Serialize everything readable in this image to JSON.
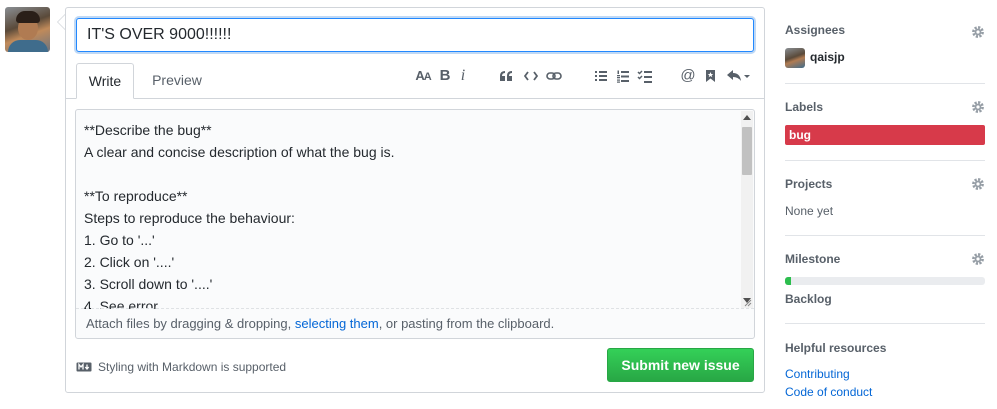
{
  "issue": {
    "title_value": "IT'S OVER 9000!!!!!!",
    "tabs": {
      "write": "Write",
      "preview": "Preview"
    },
    "toolbar": [
      {
        "name": "header-icon",
        "glyph": "AA"
      },
      {
        "name": "bold-icon",
        "glyph": "B"
      },
      {
        "name": "italic-icon",
        "glyph": "i"
      },
      {
        "name": "quote-icon",
        "glyph": "quote"
      },
      {
        "name": "code-icon",
        "glyph": "code"
      },
      {
        "name": "link-icon",
        "glyph": "link"
      },
      {
        "name": "unordered-list-icon",
        "glyph": "ul"
      },
      {
        "name": "ordered-list-icon",
        "glyph": "ol"
      },
      {
        "name": "task-list-icon",
        "glyph": "tasks"
      },
      {
        "name": "mention-icon",
        "glyph": "@"
      },
      {
        "name": "saved-reply-icon",
        "glyph": "bookmark"
      },
      {
        "name": "reply-icon",
        "glyph": "reply"
      }
    ],
    "body_lines": [
      "**Describe the bug**",
      "A clear and concise description of what the bug is.",
      "",
      "**To reproduce**",
      "Steps to reproduce the behaviour:",
      "1. Go to '...'",
      "2. Click on '....'",
      "3. Scroll down to '....'",
      "4. See error"
    ],
    "attach_prefix": "Attach files by dragging & dropping, ",
    "attach_link": "selecting them",
    "attach_suffix": ", or pasting from the clipboard.",
    "markdown_note": "Styling with Markdown is supported",
    "submit_label": "Submit new issue"
  },
  "sidebar": {
    "assignees": {
      "heading": "Assignees",
      "user": "qaisjp"
    },
    "labels": {
      "heading": "Labels",
      "items": [
        {
          "name": "bug",
          "color": "#d73a4a"
        }
      ]
    },
    "projects": {
      "heading": "Projects",
      "value": "None yet"
    },
    "milestone": {
      "heading": "Milestone",
      "name": "Backlog",
      "progress_percent": 3
    },
    "helpful": {
      "heading": "Helpful resources",
      "links": [
        "Contributing",
        "Code of conduct"
      ]
    }
  },
  "colors": {
    "submit": "#28a745",
    "link": "#0366d6",
    "label_bug": "#d73a4a",
    "focus": "#2188ff"
  }
}
